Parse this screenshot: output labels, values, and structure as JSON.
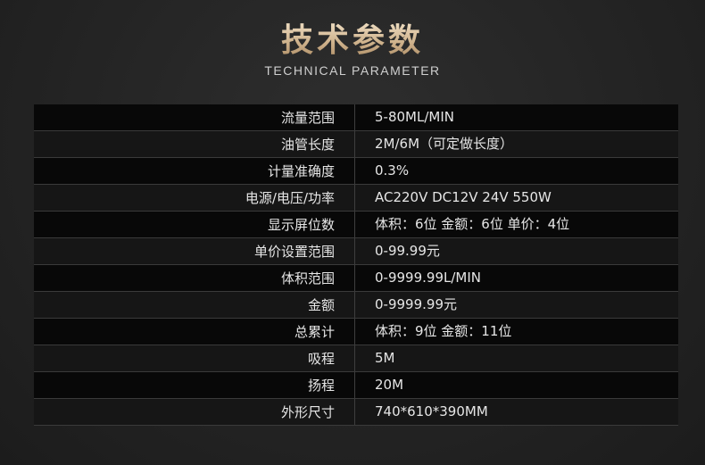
{
  "header": {
    "title_cn": "技术参数",
    "title_en": "TECHNICAL PARAMETER"
  },
  "specs": [
    {
      "label": "流量范围",
      "value": "5-80ML/MIN"
    },
    {
      "label": "油管长度",
      "value": "2M/6M（可定做长度）"
    },
    {
      "label": "计量准确度",
      "value": "0.3%"
    },
    {
      "label": "电源/电压/功率",
      "value": "AC220V  DC12V  24V  550W"
    },
    {
      "label": "显示屏位数",
      "value": "体积：6位 金额：6位  单价：4位"
    },
    {
      "label": "单价设置范围",
      "value": "0-99.99元"
    },
    {
      "label": "体积范围",
      "value": "0-9999.99L/MIN"
    },
    {
      "label": "金额",
      "value": "0-9999.99元"
    },
    {
      "label": "总累计",
      "value": "体积：9位  金额：11位"
    },
    {
      "label": "吸程",
      "value": "5M"
    },
    {
      "label": "扬程",
      "value": "20M"
    },
    {
      "label": "外形尺寸",
      "value": "740*610*390MM"
    }
  ]
}
